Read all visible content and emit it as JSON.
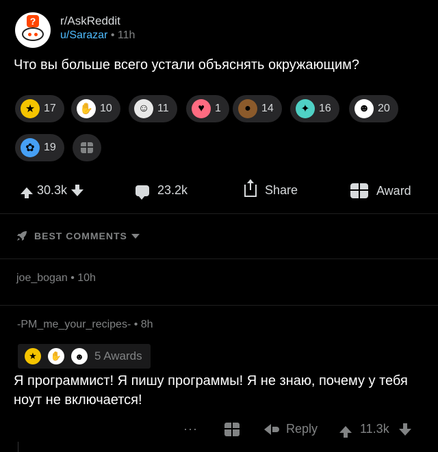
{
  "post": {
    "subreddit": "r/AskReddit",
    "author": "u/Sarazar",
    "age": "11h",
    "title": "Что вы больше всего устали объяснять окружающим?"
  },
  "awards": [
    {
      "icon": "gold-award-icon",
      "count": "17",
      "color": "#f5c400"
    },
    {
      "icon": "clapping-hands-icon",
      "count": "10",
      "color": "#ffffff"
    },
    {
      "icon": "snoo-face-icon",
      "count": "11",
      "color": "#e8e8e8"
    },
    {
      "icon": "heart-face-icon",
      "count": "1",
      "color": "#ff6b81"
    },
    {
      "icon": "pile-award-icon",
      "count": "14",
      "color": "#8b5a2b"
    },
    {
      "icon": "angel-award-icon",
      "count": "16",
      "color": "#4fd1c5"
    },
    {
      "icon": "wholesome-award-icon",
      "count": "20",
      "color": "#ffffff"
    },
    {
      "icon": "helpful-award-icon",
      "count": "19",
      "color": "#46a0f5"
    }
  ],
  "actions": {
    "votes": "30.3k",
    "comments": "23.2k",
    "share_label": "Share",
    "award_label": "Award"
  },
  "sort": {
    "label": "BEST COMMENTS"
  },
  "comments": [
    {
      "author": "joe_bogan",
      "age": "10h"
    },
    {
      "author": "-PM_me_your_recipes-",
      "age": "8h",
      "awards_label": "5 Awards",
      "body": "Я программист! Я пишу программы! Я не знаю, почему у тебя ноут не включается!",
      "reply_label": "Reply",
      "votes": "11.3k",
      "more_label": "···"
    }
  ]
}
